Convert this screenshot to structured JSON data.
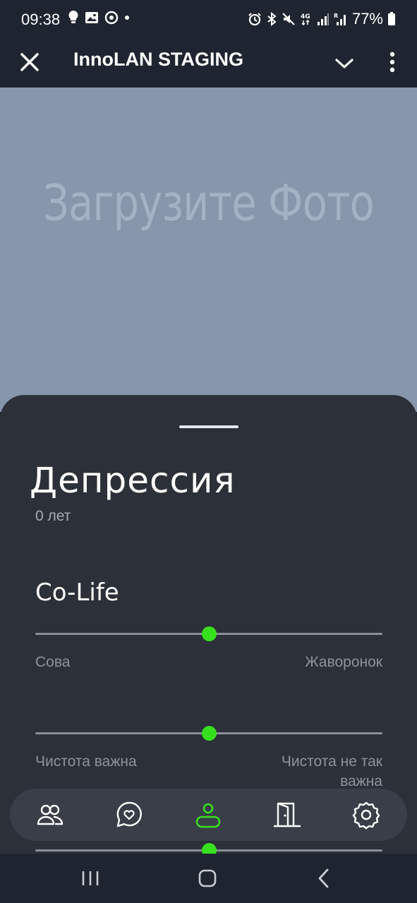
{
  "status_bar": {
    "time": "09:38",
    "left_icons": [
      "bulb-icon",
      "image-icon",
      "sync-icon",
      "dot-icon"
    ],
    "right_icons": [
      "alarm-icon",
      "bluetooth-icon",
      "mute-icon",
      "4g-icon",
      "signal-icon",
      "signal-r-icon",
      "battery-icon"
    ],
    "battery": "77%"
  },
  "app_bar": {
    "title": "InnoLAN STAGING",
    "close_icon": "close-icon",
    "dropdown_icon": "chevron-down-icon",
    "menu_icon": "more-vertical-icon"
  },
  "photo": {
    "placeholder": "Загрузите Фото",
    "background": "#8796ab"
  },
  "profile": {
    "name": "Депрессия",
    "age": "0 лет"
  },
  "colife": {
    "title": "Co-Life",
    "sliders": [
      {
        "left_label": "Сова",
        "right_label": "Жаворонок",
        "value": 0.5
      },
      {
        "left_label": "Чистота важна",
        "right_label": "Чистота не так важна",
        "value": 0.5
      },
      {
        "left_label": "",
        "right_label": "",
        "value": 0.5
      }
    ]
  },
  "bottom_nav": {
    "items": [
      {
        "icon": "people-icon",
        "active": false
      },
      {
        "icon": "heart-chat-icon",
        "active": false
      },
      {
        "icon": "profile-icon",
        "active": true
      },
      {
        "icon": "door-icon",
        "active": false
      },
      {
        "icon": "settings-icon",
        "active": false
      }
    ],
    "active_color": "#37e01f"
  },
  "system_nav": [
    "recents-icon",
    "home-icon",
    "back-icon"
  ],
  "colors": {
    "accent": "#37e01f",
    "sheet": "#2c3039",
    "nav_bar": "#393e48",
    "header": "#1f2530"
  }
}
